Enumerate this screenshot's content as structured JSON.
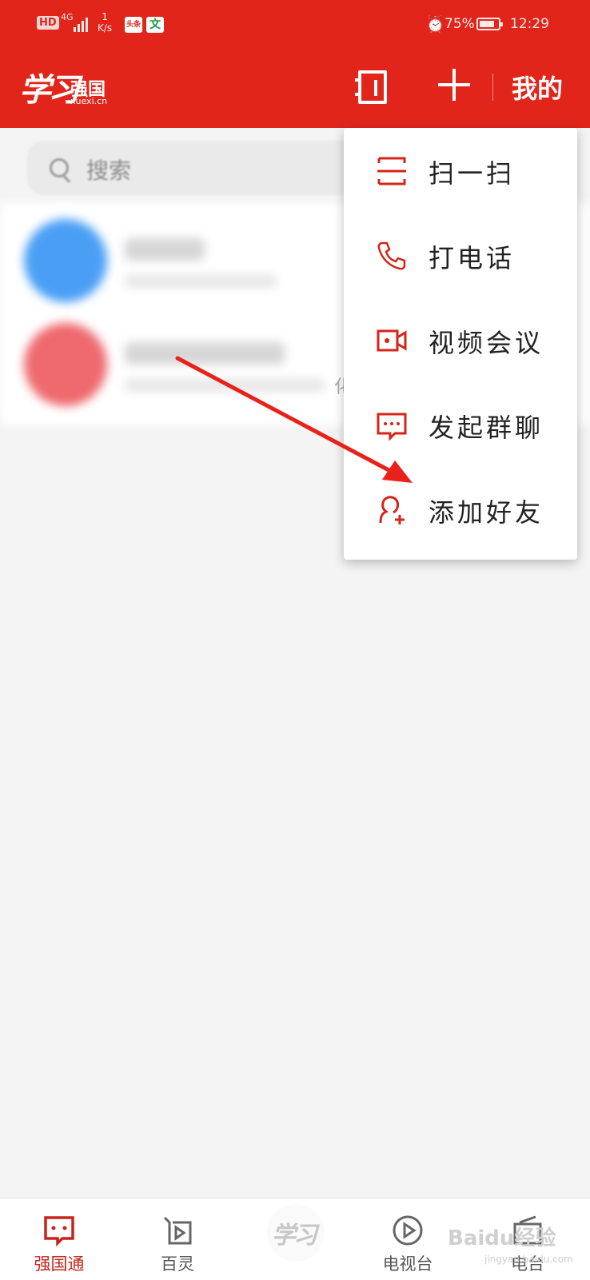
{
  "status_bar": {
    "hd": "HD",
    "network": "4G",
    "speed_value": "1",
    "speed_unit": "K/s",
    "app1": "头条",
    "app2": "文",
    "battery": "75%",
    "time": "12:29"
  },
  "header": {
    "logo_script": "学习",
    "logo_title": "强国",
    "logo_domain": "xuexi.cn",
    "mine_label": "我的"
  },
  "search": {
    "placeholder": "搜索"
  },
  "blurred_list": {
    "partial_label": "化"
  },
  "dropdown_menu": {
    "items": [
      {
        "label": "扫一扫",
        "icon": "scan-icon"
      },
      {
        "label": "打电话",
        "icon": "phone-icon"
      },
      {
        "label": "视频会议",
        "icon": "video-call-icon"
      },
      {
        "label": "发起群聊",
        "icon": "group-chat-icon"
      },
      {
        "label": "添加好友",
        "icon": "add-friend-icon"
      }
    ]
  },
  "tab_bar": {
    "tabs": [
      {
        "label": "强国通",
        "icon": "chat-bubble-icon",
        "active": true
      },
      {
        "label": "百灵",
        "icon": "play-square-icon",
        "active": false
      },
      {
        "label": "学习",
        "icon": "xuexi-logo-icon",
        "active": false
      },
      {
        "label": "电视台",
        "icon": "play-circle-icon",
        "active": false
      },
      {
        "label": "电台",
        "icon": "radio-icon",
        "active": false
      }
    ]
  },
  "watermark": {
    "text": "Baidu经验",
    "sub": "jingyan.baidu.com"
  },
  "colors": {
    "brand_red": "#e1251b",
    "icon_red": "#d4251b",
    "text_dark": "#222222"
  }
}
